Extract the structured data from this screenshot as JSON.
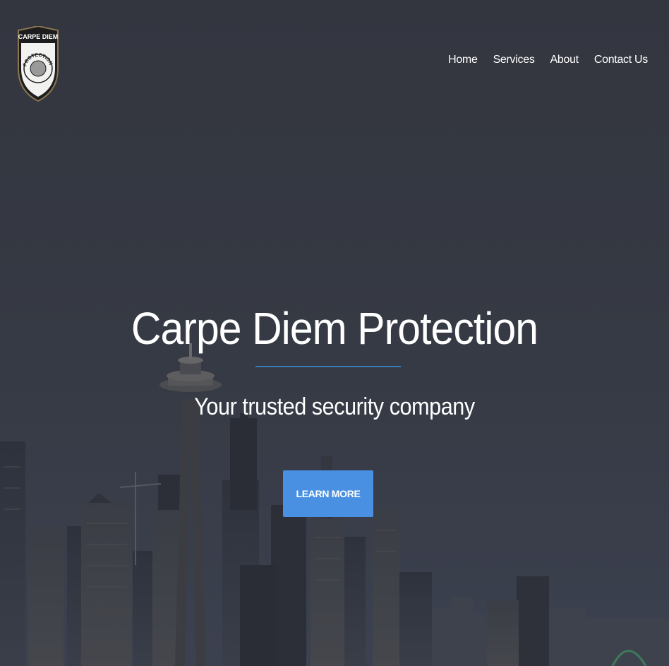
{
  "brand": {
    "logo_text_top": "CARPE DIEM",
    "logo_text_ring": "PROTECTION"
  },
  "nav": {
    "items": [
      {
        "label": "Home"
      },
      {
        "label": "Services"
      },
      {
        "label": "About"
      },
      {
        "label": "Contact Us"
      }
    ]
  },
  "hero": {
    "title": "Carpe Diem Protection",
    "subtitle": "Your trusted security company",
    "cta_label": "LEARN MORE"
  },
  "colors": {
    "overlay": "#33363f",
    "accent": "#3c79bb",
    "button": "#4a90e2",
    "text": "#ffffff"
  }
}
